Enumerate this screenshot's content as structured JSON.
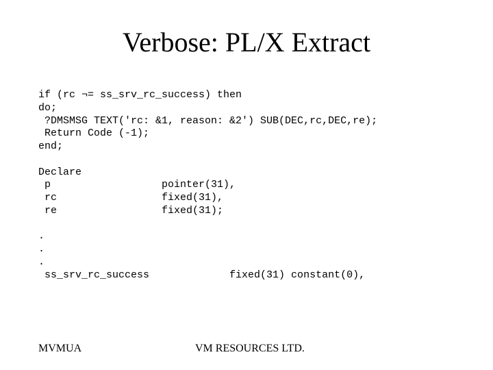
{
  "title": "Verbose: PL/X Extract",
  "code": "if (rc ¬= ss_srv_rc_success) then\ndo;\n ?DMSMSG TEXT('rc: &1, reason: &2') SUB(DEC,rc,DEC,re);\n Return Code (-1);\nend;\n\nDeclare\n p                  pointer(31),\n rc                 fixed(31),\n re                 fixed(31);\n\n.\n.\n.\n ss_srv_rc_success             fixed(31) constant(0),",
  "footer": {
    "left": "MVMUA",
    "center": "VM RESOURCES LTD."
  }
}
